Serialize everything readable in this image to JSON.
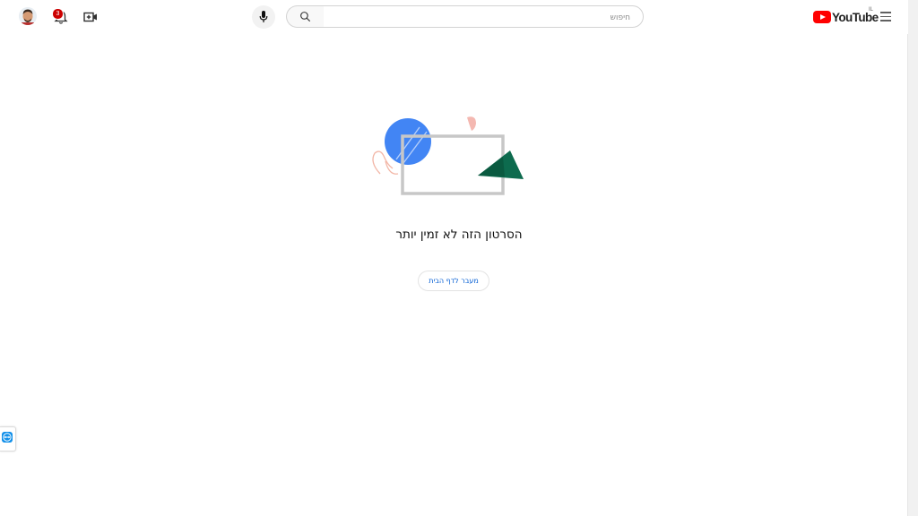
{
  "header": {
    "logo_text": "YouTube",
    "logo_region": "IL",
    "search_placeholder": "חיפוש",
    "notification_count": "3",
    "colors": {
      "brand_red": "#ff0000",
      "badge_red": "#cc0000"
    }
  },
  "icons": {
    "menu": "hamburger-menu-icon",
    "search": "search-icon",
    "mic": "microphone-icon",
    "create": "create-video-icon",
    "bell": "bell-icon",
    "avatar": "user-avatar"
  },
  "main": {
    "message": "הסרטון הזה לא זמין יותר",
    "home_button_label": "מעבר לדף הבית",
    "colors": {
      "link_blue": "#065fd4",
      "circle_blue": "#4285f4",
      "triangle_green": "#0d6b4e"
    }
  }
}
